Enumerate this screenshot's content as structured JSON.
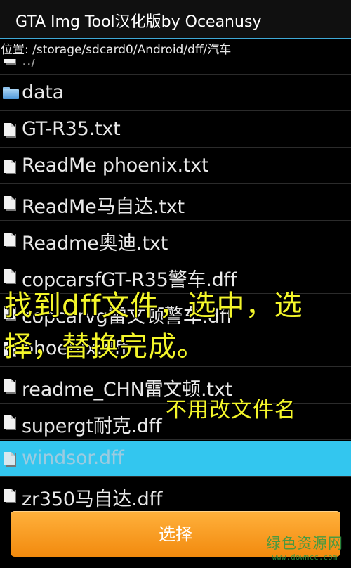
{
  "app": {
    "title": "GTA Img Tool汉化版by Oceanusy"
  },
  "path": {
    "text": "位置: /storage/sdcard0/Android/dff/汽车"
  },
  "files": {
    "parent": "../",
    "items": [
      {
        "name": "data",
        "type": "folder",
        "icon": "folder-icon"
      },
      {
        "name": "GT-R35.txt",
        "type": "file",
        "icon": "file-icon"
      },
      {
        "name": "ReadMe phoenix.txt",
        "type": "file",
        "icon": "file-icon"
      },
      {
        "name": "ReadMe马自达.txt",
        "type": "file",
        "icon": "file-icon"
      },
      {
        "name": "Readme奥迪.txt",
        "type": "file",
        "icon": "file-icon"
      },
      {
        "name": "copcarsfGT-R35警车.dff",
        "type": "file",
        "icon": "file-icon"
      },
      {
        "name": "copcarvg雷文顿警车.dff",
        "type": "file",
        "icon": "file-icon"
      },
      {
        "name": "phoenix.dff",
        "type": "file",
        "icon": "file-icon"
      },
      {
        "name": "readme_CHN雷文顿.txt",
        "type": "file",
        "icon": "file-icon"
      },
      {
        "name": "supergt耐克.dff",
        "type": "file",
        "icon": "file-icon"
      },
      {
        "name": "windsor.dff",
        "type": "file",
        "icon": "file-icon",
        "selected": true
      },
      {
        "name": "zr350马自达.dff",
        "type": "file",
        "icon": "file-icon"
      }
    ]
  },
  "annotations": {
    "line1": "找到dff文件，选中，选",
    "line2": "择，替换完成。",
    "note": "不用改文件名",
    "color": "#f4f62a"
  },
  "actions": {
    "select_label": "选择",
    "button_color": "#f59a1f"
  },
  "watermark": {
    "name": "绿色资源网",
    "url": "www.downcc.com"
  },
  "colors": {
    "accent": "#3fa9d6",
    "selected_row": "#33c6ef",
    "background": "#000000"
  }
}
